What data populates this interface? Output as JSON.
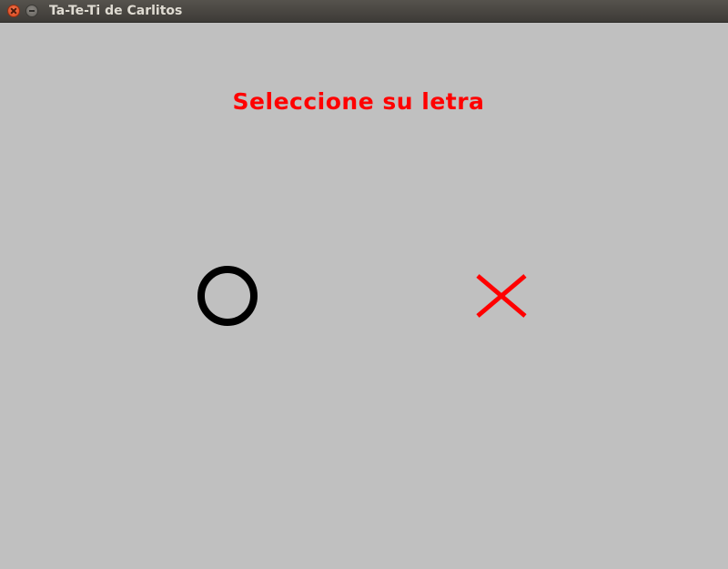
{
  "window": {
    "title": "Ta-Te-Ti de Carlitos"
  },
  "game": {
    "prompt": "Seleccione su letra",
    "prompt_color": "#ff0000",
    "options": [
      {
        "letter": "O",
        "icon": "circle-o-icon",
        "color": "#000000"
      },
      {
        "letter": "X",
        "icon": "cross-x-icon",
        "color": "#ff0000"
      }
    ]
  },
  "colors": {
    "background": "#c0c0c0",
    "titlebar": "#45433f",
    "title_text": "#dfdbd2"
  }
}
